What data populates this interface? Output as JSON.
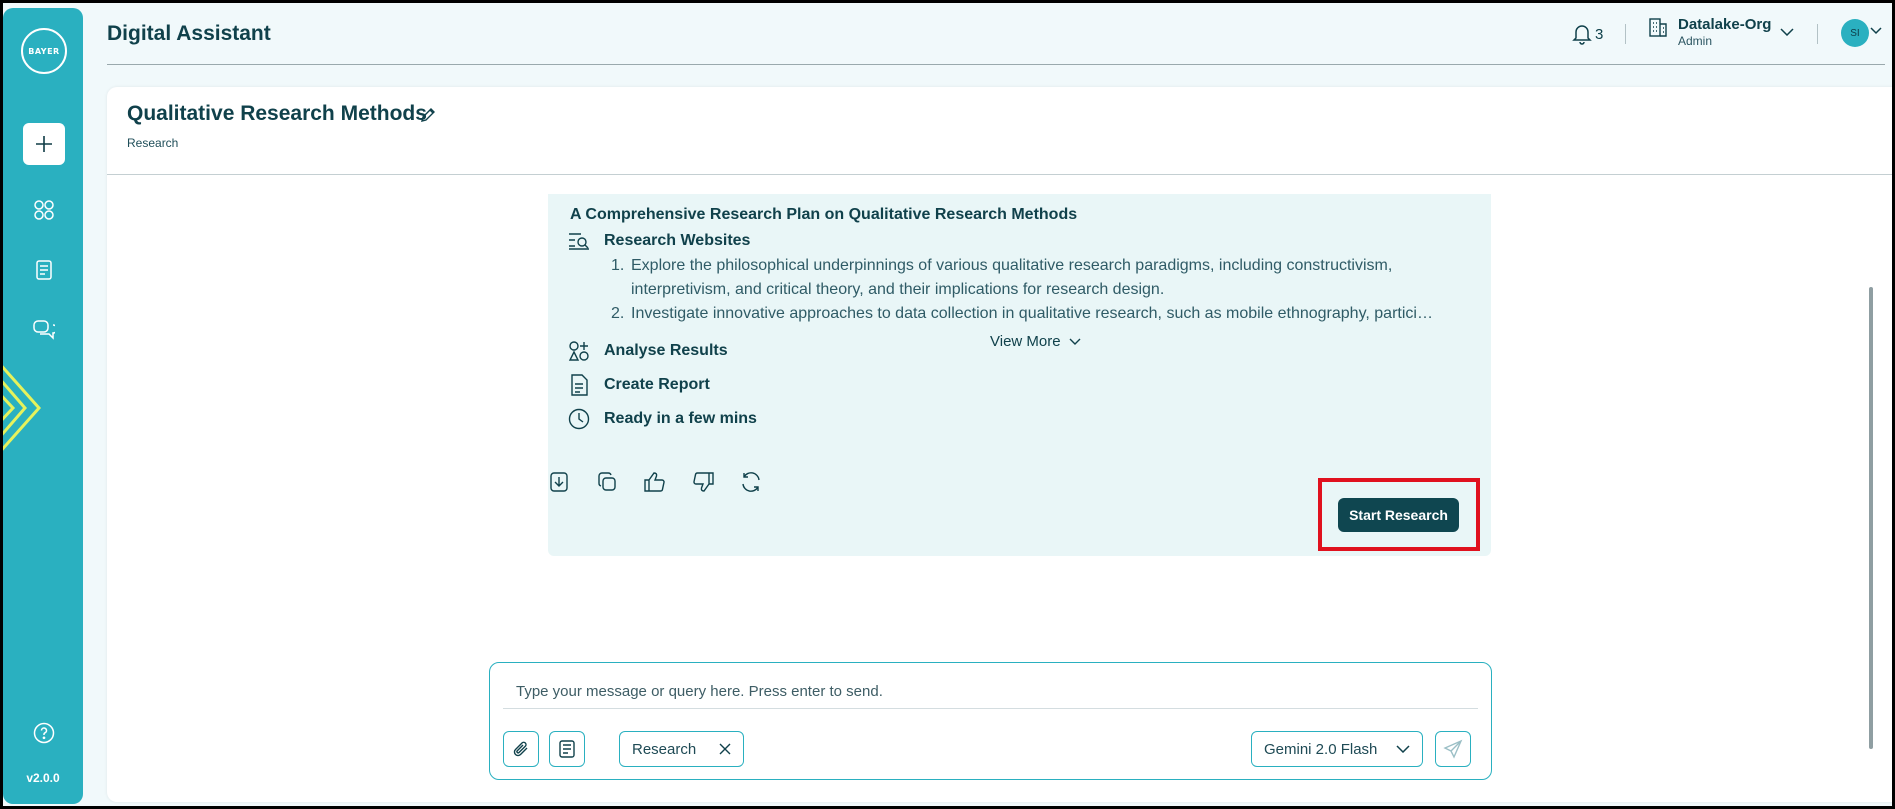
{
  "app": {
    "title": "Digital Assistant",
    "version": "v2.0.0"
  },
  "sidebar": {
    "logo_text": "BAYER",
    "items": [
      {
        "name": "new-chat",
        "icon": "plus-icon"
      },
      {
        "name": "apps",
        "icon": "grid-icon"
      },
      {
        "name": "documents",
        "icon": "document-icon"
      },
      {
        "name": "chats",
        "icon": "chat-bubbles-icon"
      }
    ],
    "help_icon": "help-icon"
  },
  "header": {
    "notifications_count": "3",
    "org_name": "Datalake-Org",
    "org_role": "Admin",
    "avatar_initials": "SI"
  },
  "page": {
    "title": "Qualitative Research Methods",
    "subtitle": "Research"
  },
  "plan": {
    "title": "A Comprehensive Research Plan on Qualitative Research Methods",
    "steps": [
      {
        "label": "Research Websites",
        "icon": "search-list-icon"
      },
      {
        "label": "Analyse Results",
        "icon": "analyse-icon"
      },
      {
        "label": "Create Report",
        "icon": "report-icon"
      },
      {
        "label": "Ready in a few mins",
        "icon": "clock-icon"
      }
    ],
    "items": [
      {
        "num": "1.",
        "text": "Explore the philosophical underpinnings of various qualitative research paradigms, including constructivism, interpretivism, and critical theory, and their implications for research design."
      },
      {
        "num": "2.",
        "text": "Investigate innovative approaches to data collection in qualitative research, such as mobile ethnography, participatory video and digital diaries"
      }
    ],
    "view_more": "View More",
    "start_button": "Start Research"
  },
  "composer": {
    "placeholder": "Type your message or query here. Press enter to send.",
    "chip_label": "Research",
    "model": "Gemini 2.0 Flash"
  },
  "colors": {
    "sidebar": "#2ab0c0",
    "primary_dark": "#0f4650",
    "card_bg": "#e9f6f7",
    "highlight": "#e0111e"
  }
}
